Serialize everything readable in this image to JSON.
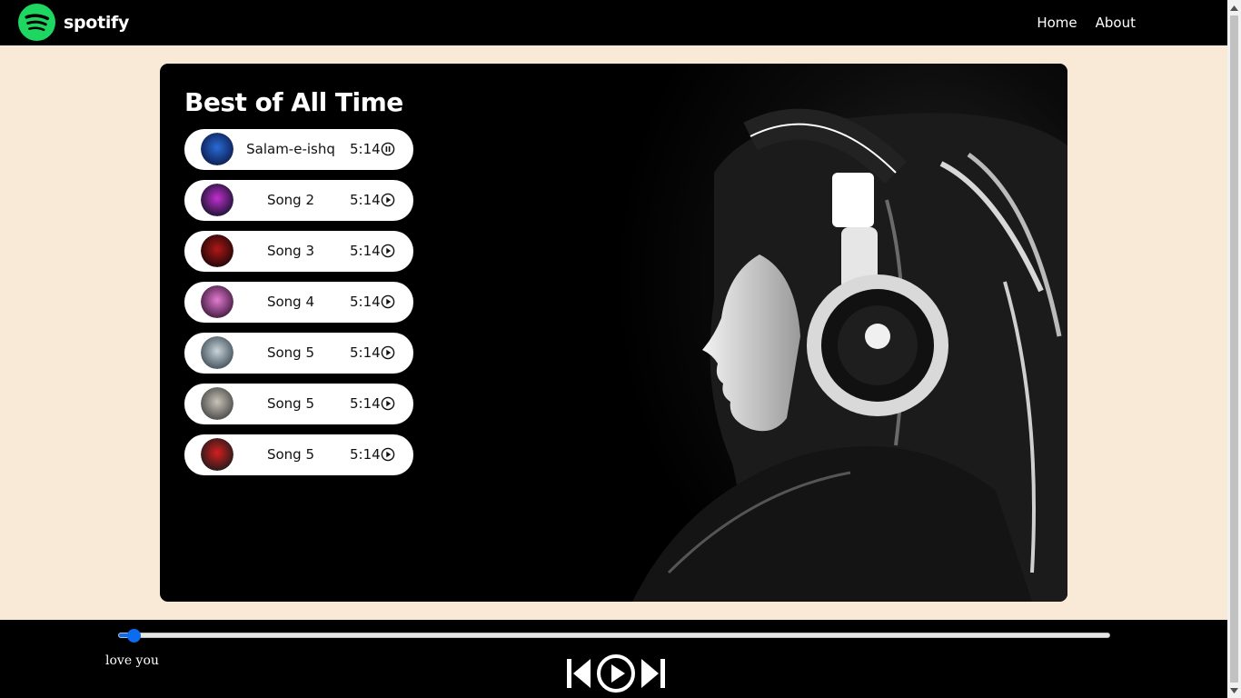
{
  "app": {
    "brand": "spotify",
    "accent_color": "#1ed760"
  },
  "nav": {
    "links": [
      {
        "label": "Home"
      },
      {
        "label": "About"
      }
    ]
  },
  "playlist": {
    "title": "Best of All Time",
    "songs": [
      {
        "name": "Salam-e-ishq",
        "duration": "5:14",
        "state_icon": "pause-circle-icon",
        "cover_colors": [
          "#0b1a4a",
          "#2a6bd6"
        ]
      },
      {
        "name": "Song 2",
        "duration": "5:14",
        "state_icon": "play-circle-icon",
        "cover_colors": [
          "#12122a",
          "#c22fd0"
        ]
      },
      {
        "name": "Song 3",
        "duration": "5:14",
        "state_icon": "play-circle-icon",
        "cover_colors": [
          "#1a0606",
          "#b01818"
        ]
      },
      {
        "name": "Song 4",
        "duration": "5:14",
        "state_icon": "play-circle-icon",
        "cover_colors": [
          "#3a1638",
          "#e37bd2"
        ]
      },
      {
        "name": "Song 5",
        "duration": "5:14",
        "state_icon": "play-circle-icon",
        "cover_colors": [
          "#3d4b55",
          "#c9d4da"
        ]
      },
      {
        "name": "Song 5",
        "duration": "5:14",
        "state_icon": "play-circle-icon",
        "cover_colors": [
          "#444",
          "#c9c3b8"
        ]
      },
      {
        "name": "Song 5",
        "duration": "5:14",
        "state_icon": "play-circle-icon",
        "cover_colors": [
          "#1a1a1a",
          "#d41f1f"
        ]
      }
    ]
  },
  "player": {
    "now_playing": "love you",
    "progress_fraction": 0.015,
    "progress_color": "#0a6cf1",
    "controls": [
      "previous-icon",
      "play-circle-icon",
      "next-icon"
    ]
  }
}
